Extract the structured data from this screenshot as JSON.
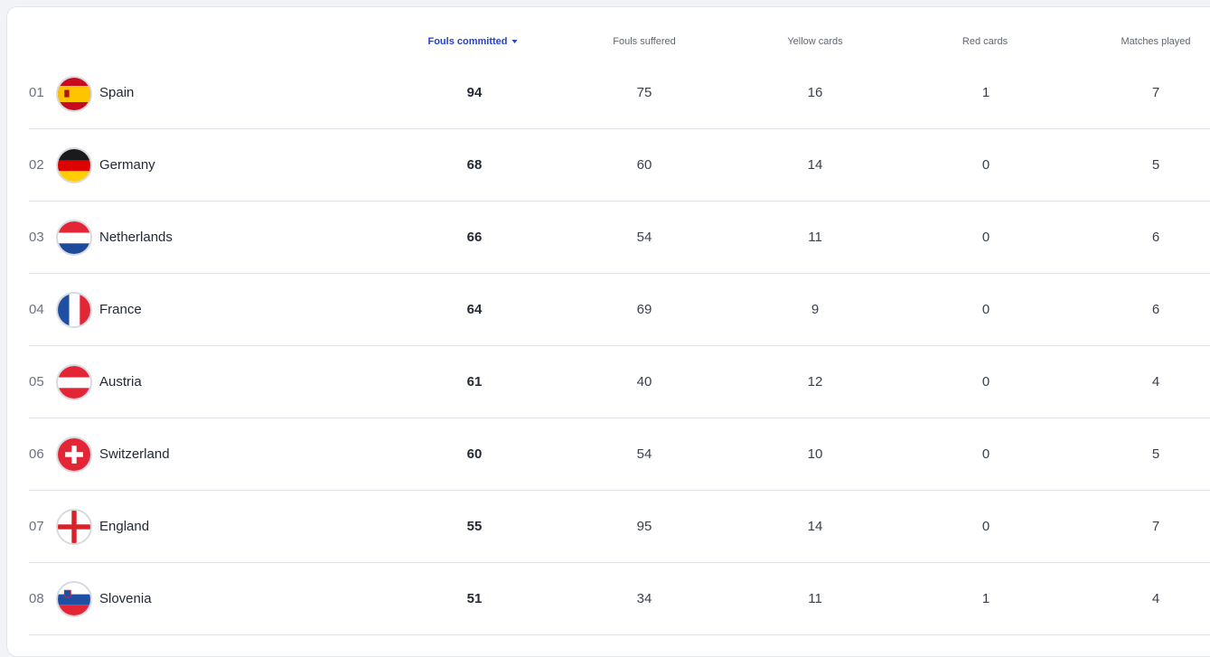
{
  "columns": {
    "fouls_committed": "Fouls committed",
    "fouls_suffered": "Fouls suffered",
    "yellow_cards": "Yellow cards",
    "red_cards": "Red cards",
    "matches_played": "Matches played"
  },
  "sort": {
    "column": "fouls_committed",
    "direction": "desc"
  },
  "rows": [
    {
      "rank": "01",
      "team": "Spain",
      "flag_icon": "spain-flag-icon",
      "fouls_committed": "94",
      "fouls_suffered": "75",
      "yellow_cards": "16",
      "red_cards": "1",
      "matches_played": "7"
    },
    {
      "rank": "02",
      "team": "Germany",
      "flag_icon": "germany-flag-icon",
      "fouls_committed": "68",
      "fouls_suffered": "60",
      "yellow_cards": "14",
      "red_cards": "0",
      "matches_played": "5"
    },
    {
      "rank": "03",
      "team": "Netherlands",
      "flag_icon": "netherlands-flag-icon",
      "fouls_committed": "66",
      "fouls_suffered": "54",
      "yellow_cards": "11",
      "red_cards": "0",
      "matches_played": "6"
    },
    {
      "rank": "04",
      "team": "France",
      "flag_icon": "france-flag-icon",
      "fouls_committed": "64",
      "fouls_suffered": "69",
      "yellow_cards": "9",
      "red_cards": "0",
      "matches_played": "6"
    },
    {
      "rank": "05",
      "team": "Austria",
      "flag_icon": "austria-flag-icon",
      "fouls_committed": "61",
      "fouls_suffered": "40",
      "yellow_cards": "12",
      "red_cards": "0",
      "matches_played": "4"
    },
    {
      "rank": "06",
      "team": "Switzerland",
      "flag_icon": "switzerland-flag-icon",
      "fouls_committed": "60",
      "fouls_suffered": "54",
      "yellow_cards": "10",
      "red_cards": "0",
      "matches_played": "5"
    },
    {
      "rank": "07",
      "team": "England",
      "flag_icon": "england-flag-icon",
      "fouls_committed": "55",
      "fouls_suffered": "95",
      "yellow_cards": "14",
      "red_cards": "0",
      "matches_played": "7"
    },
    {
      "rank": "08",
      "team": "Slovenia",
      "flag_icon": "slovenia-flag-icon",
      "fouls_committed": "51",
      "fouls_suffered": "34",
      "yellow_cards": "11",
      "red_cards": "1",
      "matches_played": "4"
    }
  ],
  "colors": {
    "accent": "#2640d4",
    "divider": "#e3e5ea"
  }
}
